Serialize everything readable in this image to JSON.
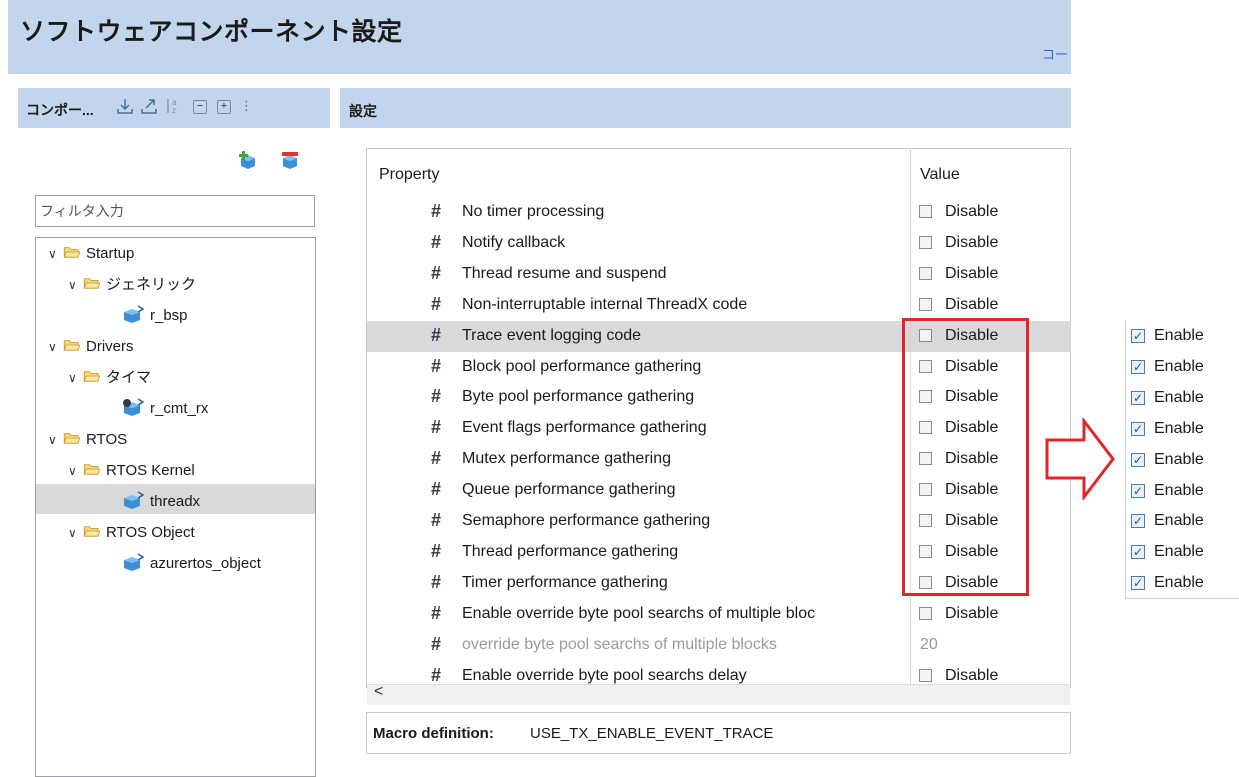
{
  "header": {
    "title": "ソフトウェアコンポーネント設定",
    "link": "コー"
  },
  "left_panel": {
    "title": "コンポー...",
    "filter_placeholder": "フィルタ入力",
    "tree": [
      {
        "label": "Startup",
        "level": 0,
        "kind": "folder"
      },
      {
        "label": "ジェネリック",
        "level": 1,
        "kind": "folder"
      },
      {
        "label": "r_bsp",
        "level": 2,
        "kind": "component"
      },
      {
        "label": "Drivers",
        "level": 0,
        "kind": "folder"
      },
      {
        "label": "タイマ",
        "level": 1,
        "kind": "folder"
      },
      {
        "label": "r_cmt_rx",
        "level": 2,
        "kind": "component"
      },
      {
        "label": "RTOS",
        "level": 0,
        "kind": "folder"
      },
      {
        "label": "RTOS Kernel",
        "level": 1,
        "kind": "folder"
      },
      {
        "label": "threadx",
        "level": 2,
        "kind": "component",
        "selected": true
      },
      {
        "label": "RTOS Object",
        "level": 1,
        "kind": "folder"
      },
      {
        "label": "azurertos_object",
        "level": 2,
        "kind": "component"
      }
    ]
  },
  "settings": {
    "title": "設定",
    "columns": {
      "property": "Property",
      "value": "Value"
    },
    "rows": [
      {
        "name": "No timer processing",
        "value": "Disable",
        "checkbox": true
      },
      {
        "name": "Notify callback",
        "value": "Disable",
        "checkbox": true
      },
      {
        "name": "Thread resume and suspend",
        "value": "Disable",
        "checkbox": true
      },
      {
        "name": "Non-interruptable internal ThreadX code",
        "value": "Disable",
        "checkbox": true
      },
      {
        "name": "Trace event logging code",
        "value": "Disable",
        "checkbox": true,
        "selected": true
      },
      {
        "name": "Block pool performance gathering",
        "value": "Disable",
        "checkbox": true
      },
      {
        "name": "Byte pool performance gathering",
        "value": "Disable",
        "checkbox": true
      },
      {
        "name": "Event flags performance gathering",
        "value": "Disable",
        "checkbox": true
      },
      {
        "name": "Mutex performance gathering",
        "value": "Disable",
        "checkbox": true
      },
      {
        "name": "Queue performance gathering",
        "value": "Disable",
        "checkbox": true
      },
      {
        "name": "Semaphore performance gathering",
        "value": "Disable",
        "checkbox": true
      },
      {
        "name": "Thread performance gathering",
        "value": "Disable",
        "checkbox": true
      },
      {
        "name": "Timer performance gathering",
        "value": "Disable",
        "checkbox": true
      },
      {
        "name": "Enable override byte pool searchs of multiple bloc",
        "value": "Disable",
        "checkbox": true
      },
      {
        "name": "override byte pool searchs of multiple blocks",
        "value": "20",
        "checkbox": false,
        "disabled": true
      },
      {
        "name": "Enable override byte pool searchs delay",
        "value": "Disable",
        "checkbox": true
      }
    ],
    "macro_label": "Macro definition:",
    "macro_value": "USE_TX_ENABLE_EVENT_TRACE"
  },
  "after_panel": {
    "items": [
      "Enable",
      "Enable",
      "Enable",
      "Enable",
      "Enable",
      "Enable",
      "Enable",
      "Enable",
      "Enable"
    ]
  },
  "colors": {
    "header_bg": "#c3d5ec",
    "highlight": "#e0252b",
    "selected_row": "#d9d9d9"
  }
}
